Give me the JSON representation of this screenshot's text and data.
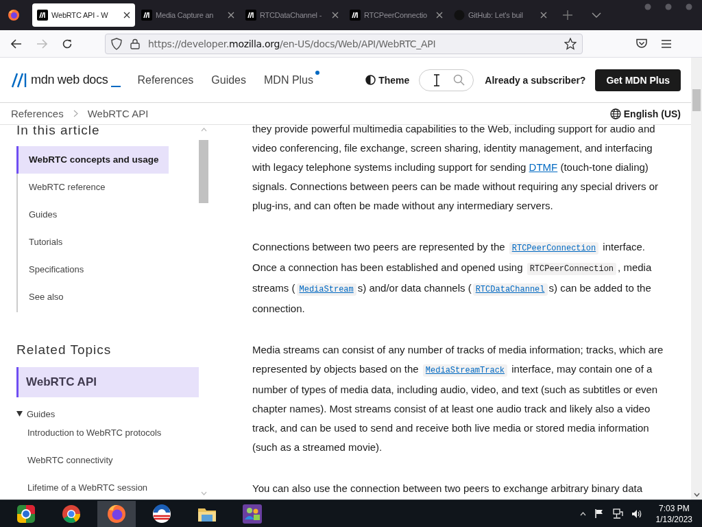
{
  "browser": {
    "tabs": [
      {
        "title": "WebRTC API - W",
        "kind": "mdn",
        "selected": true
      },
      {
        "title": "Media Capture an",
        "kind": "mdn",
        "selected": false
      },
      {
        "title": "RTCDataChannel -",
        "kind": "mdn",
        "selected": false
      },
      {
        "title": "RTCPeerConnectio",
        "kind": "mdn",
        "selected": false
      },
      {
        "title": "GitHub: Let's buil",
        "kind": "github",
        "selected": false
      }
    ],
    "address": {
      "prefix": "https://developer.",
      "domain": "mozilla.org",
      "path": "/en-US/docs/Web/API/WebRTC_API"
    },
    "forward_disabled": true
  },
  "header": {
    "logo": "mdn web docs",
    "nav": [
      {
        "label": "References",
        "dot": false
      },
      {
        "label": "Guides",
        "dot": false
      },
      {
        "label": "MDN Plus",
        "dot": true
      }
    ],
    "theme": "Theme",
    "subscriber_link": "Already a subscriber?",
    "cta": "Get MDN Plus"
  },
  "breadcrumb": {
    "items": [
      "References",
      "WebRTC API"
    ],
    "language": "English (US)"
  },
  "sidebar": {
    "toc_title": "In this article",
    "toc": [
      {
        "label": "WebRTC concepts and usage",
        "selected": true
      },
      {
        "label": "WebRTC reference",
        "selected": false
      },
      {
        "label": "Guides",
        "selected": false
      },
      {
        "label": "Tutorials",
        "selected": false
      },
      {
        "label": "Specifications",
        "selected": false
      },
      {
        "label": "See also",
        "selected": false
      }
    ],
    "related_title": "Related Topics",
    "current": "WebRTC API",
    "groups": [
      {
        "label": "Guides",
        "expanded": true,
        "children": [
          "Introduction to WebRTC protocols",
          "WebRTC connectivity",
          "Lifetime of a WebRTC session"
        ]
      }
    ]
  },
  "article": {
    "paragraphs": [
      [
        {
          "kind": "text",
          "text": "they provide powerful multimedia capabilities to the Web, including support for audio and video conferencing, file exchange, screen sharing, identity management, and interfacing with legacy telephone systems including support for sending "
        },
        {
          "kind": "link",
          "text": "DTMF"
        },
        {
          "kind": "text",
          "text": " (touch-tone dialing) signals. Connections between peers can be made without requiring any special drivers or plug-ins, and can often be made without any intermediary servers."
        }
      ],
      [
        {
          "kind": "text",
          "text": "Connections between two peers are represented by the "
        },
        {
          "kind": "codelink",
          "text": "RTCPeerConnection"
        },
        {
          "kind": "text",
          "text": " interface. Once a connection has been established and opened using "
        },
        {
          "kind": "code",
          "text": "RTCPeerConnection"
        },
        {
          "kind": "text",
          "text": ", media streams ("
        },
        {
          "kind": "codelink",
          "text": "MediaStream"
        },
        {
          "kind": "text",
          "text": "s) and/or data channels ("
        },
        {
          "kind": "codelink",
          "text": "RTCDataChannel"
        },
        {
          "kind": "text",
          "text": "s) can be added to the connection."
        }
      ],
      [
        {
          "kind": "text",
          "text": "Media streams can consist of any number of tracks of media information; tracks, which are represented by objects based on the "
        },
        {
          "kind": "codelink",
          "text": "MediaStreamTrack"
        },
        {
          "kind": "text",
          "text": " interface, may contain one of a number of types of media data, including audio, video, and text (such as subtitles or even chapter names). Most streams consist of at least one audio track and likely also a video track, and can be used to send and receive both live media or stored media information (such as a streamed movie)."
        }
      ],
      [
        {
          "kind": "text",
          "text": "You can also use the connection between two peers to exchange arbitrary binary data"
        }
      ]
    ]
  },
  "taskbar": {
    "apps": [
      {
        "kind": "chromium",
        "selected": false
      },
      {
        "kind": "chrome",
        "selected": false
      },
      {
        "kind": "firefox",
        "selected": true
      },
      {
        "kind": "campaign",
        "selected": false
      },
      {
        "kind": "folder",
        "selected": false
      },
      {
        "kind": "messenger",
        "selected": false
      }
    ],
    "time": "7:03 PM",
    "date": "1/13/2023"
  }
}
